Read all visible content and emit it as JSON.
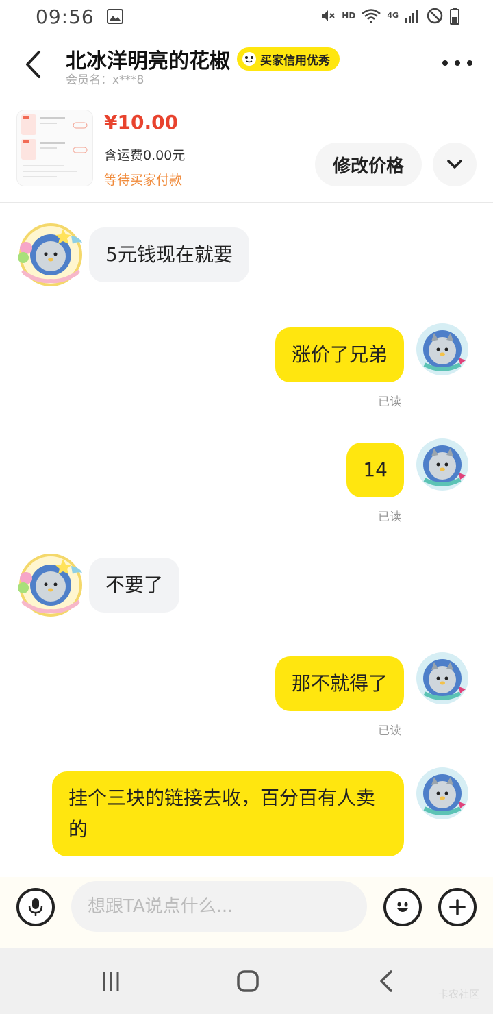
{
  "status_bar": {
    "time": "09:56",
    "hd": "HD",
    "network": "4G"
  },
  "header": {
    "title": "北冰洋明亮的花椒",
    "credit_badge": "买家信用优秀",
    "member_label": "会员名：x***8"
  },
  "order": {
    "price": "¥10.00",
    "shipping": "含运费0.00元",
    "status": "等待买家付款",
    "edit_price_label": "修改价格"
  },
  "messages": [
    {
      "from": "other",
      "text": "5元钱现在就要"
    },
    {
      "from": "me",
      "text": "涨价了兄弟",
      "read": "已读"
    },
    {
      "from": "me",
      "text": "14",
      "read": "已读"
    },
    {
      "from": "other",
      "text": "不要了"
    },
    {
      "from": "me",
      "text": "那不就得了",
      "read": "已读"
    },
    {
      "from": "me",
      "text": "挂个三块的链接去收，百分百有人卖的"
    }
  ],
  "input": {
    "placeholder": "想跟TA说点什么..."
  },
  "watermark": "卡农社区",
  "colors": {
    "accent_yellow": "#ffe60f",
    "price_red": "#e8432e",
    "status_orange": "#f08a3a"
  }
}
